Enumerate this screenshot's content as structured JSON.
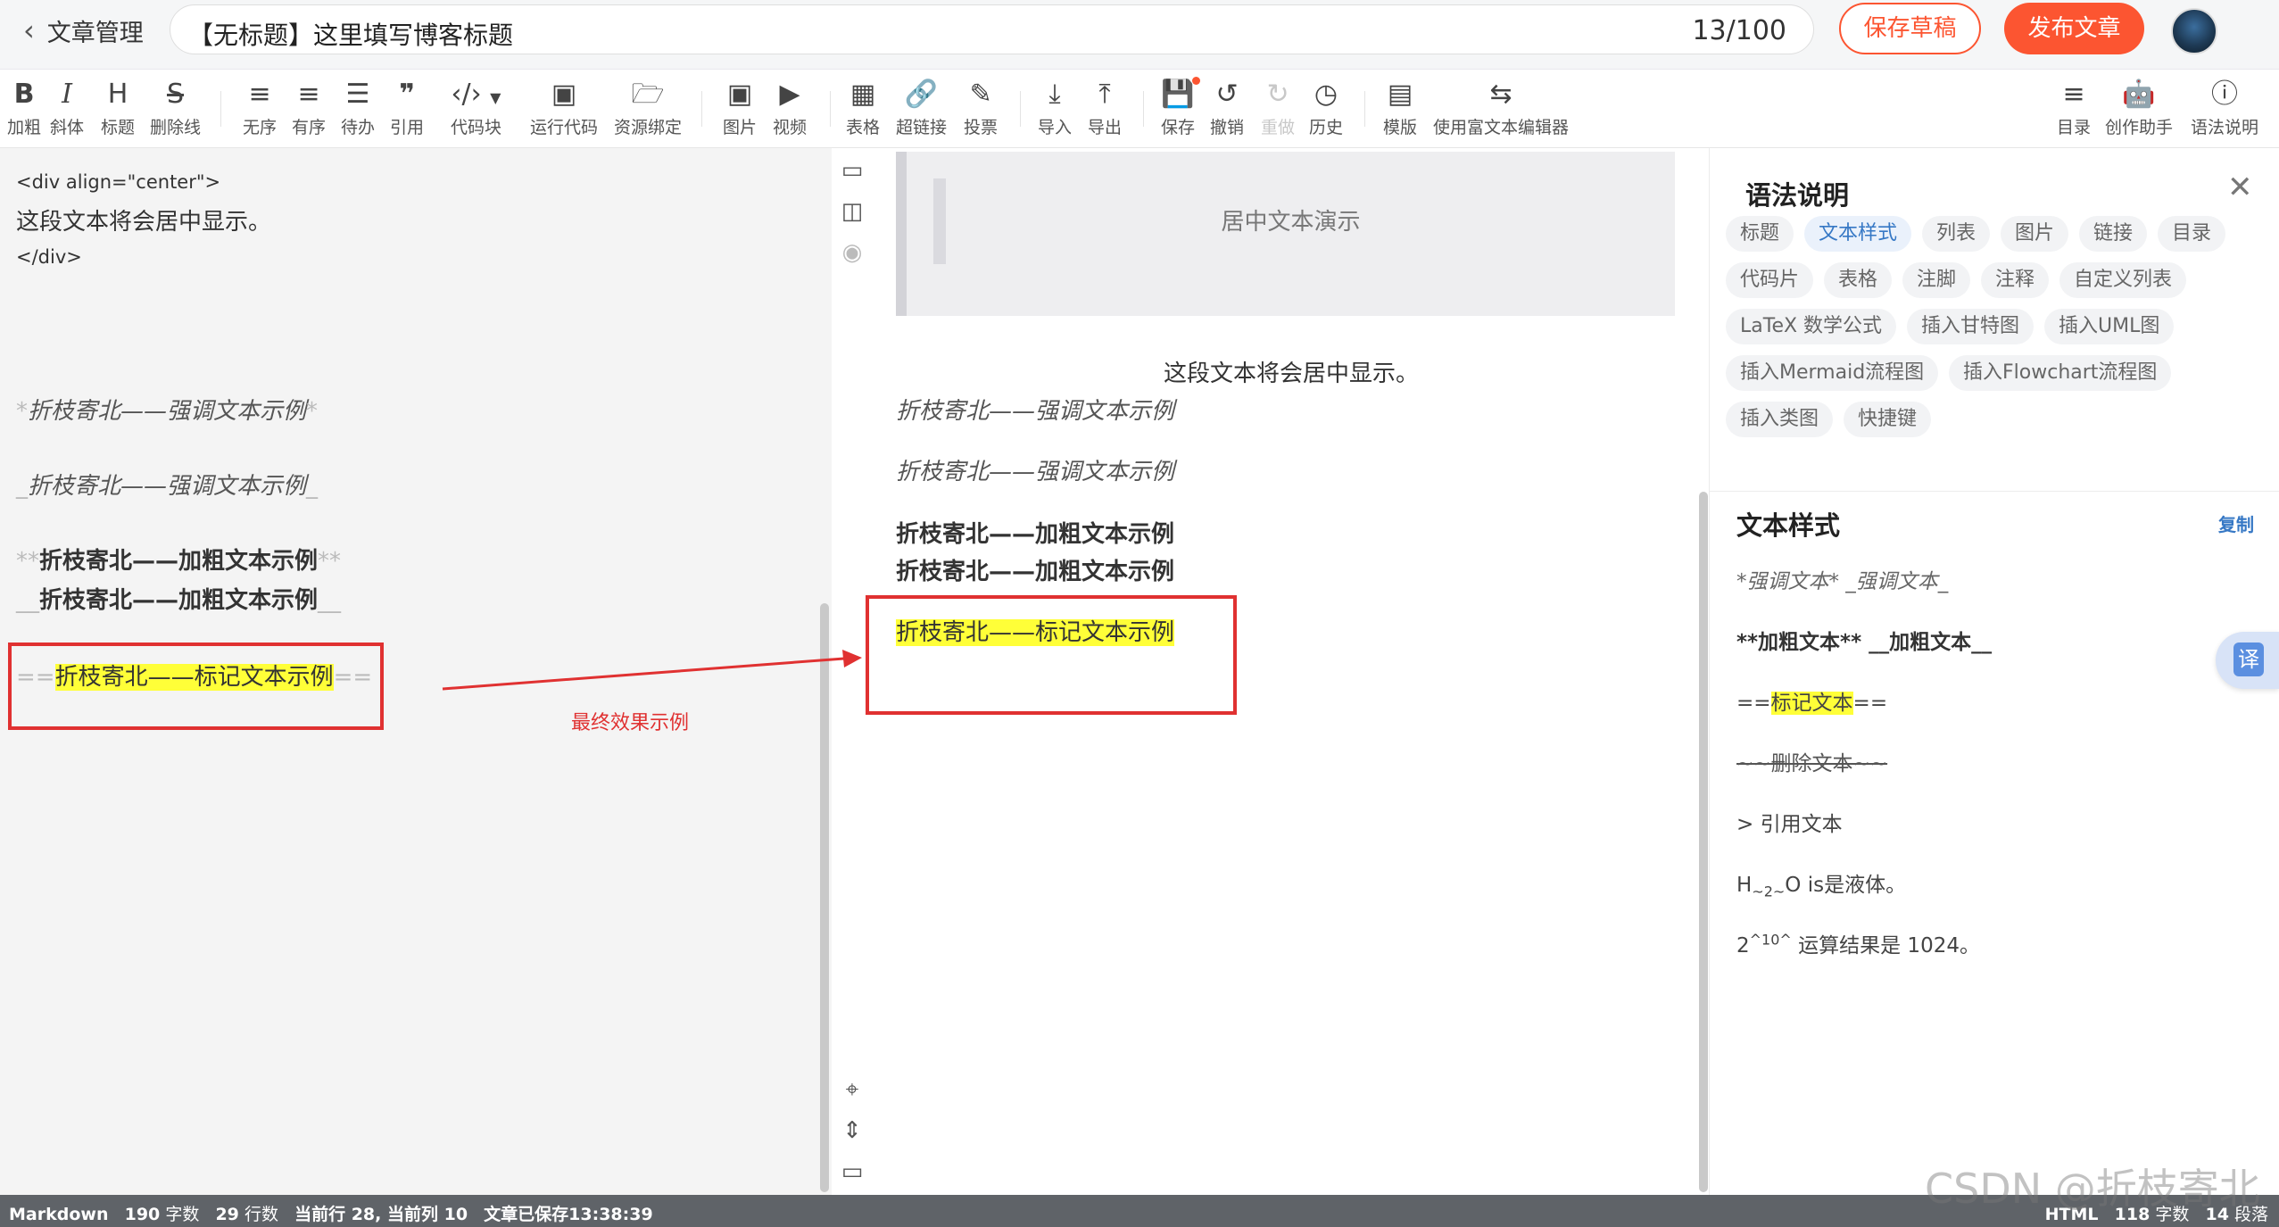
{
  "header": {
    "back_label": "文章管理",
    "title": "【无标题】这里填写博客标题",
    "title_count": "13/100",
    "save_draft": "保存草稿",
    "publish": "发布文章"
  },
  "toolbar": {
    "bold": "加粗",
    "italic": "斜体",
    "heading": "标题",
    "strike": "删除线",
    "unordered": "无序",
    "ordered": "有序",
    "todo": "待办",
    "quote": "引用",
    "codeblock": "代码块",
    "run_code": "运行代码",
    "resource": "资源绑定",
    "image": "图片",
    "video": "视频",
    "table": "表格",
    "link": "超链接",
    "vote": "投票",
    "import": "导入",
    "export": "导出",
    "save": "保存",
    "undo": "撤销",
    "redo": "重做",
    "history": "历史",
    "template": "模版",
    "rich_editor": "使用富文本编辑器",
    "toc": "目录",
    "assistant": "创作助手",
    "syntax_help": "语法说明"
  },
  "editor": {
    "line1": "<div align=\"center\">",
    "line2": "这段文本将会居中显示。",
    "line3": "</div>",
    "em_star_text": "折枝寄北——强调文本示例",
    "em_star_mark": "*",
    "em_us_text": "折枝寄北——强调文本示例",
    "em_us_mark": "_",
    "bold_star_mark": "**",
    "bold_star_text": "折枝寄北——加粗文本示例",
    "bold_us_mark": "__",
    "bold_us_text": "折枝寄北——加粗文本示例",
    "mark_marker": "==",
    "mark_text": "折枝寄北——标记文本示例"
  },
  "preview": {
    "quote_text": "居中文本演示",
    "center_text": "这段文本将会居中显示。",
    "em1": "折枝寄北——强调文本示例",
    "em2": "折枝寄北——强调文本示例",
    "bold1": "折枝寄北——加粗文本示例",
    "bold2": "折枝寄北——加粗文本示例",
    "mark": "折枝寄北——标记文本示例"
  },
  "annotation": {
    "label": "最终效果示例"
  },
  "panel": {
    "title": "语法说明",
    "tags": [
      "标题",
      "文本样式",
      "列表",
      "图片",
      "链接",
      "目录",
      "代码片",
      "表格",
      "注脚",
      "注释",
      "自定义列表",
      "LaTeX 数学公式",
      "插入甘特图",
      "插入UML图",
      "插入Mermaid流程图",
      "插入Flowchart流程图",
      "插入类图",
      "快捷键"
    ],
    "active_tag": "文本样式",
    "section_title": "文本样式",
    "copy": "复制",
    "ex_em": "*强调文本* _强调文本_",
    "ex_bold": "**加粗文本** __加粗文本__",
    "ex_mark_marker": "==",
    "ex_mark_text": "标记文本",
    "ex_del": "~~删除文本~~",
    "ex_quote": "> 引用文本",
    "ex_sub_pre": "H",
    "ex_sub": "~2~",
    "ex_sub_post": "O is是液体。",
    "ex_sup_pre": "2",
    "ex_sup": "^10^",
    "ex_sup_post": " 运算结果是 1024。",
    "translate": "译"
  },
  "status": {
    "mode": "Markdown",
    "chars": "190",
    "chars_unit": "字数",
    "lines": "29",
    "lines_unit": "行数",
    "cursor": "当前行 28, 当前列 10",
    "saved": "文章已保存13:38:39",
    "right_mode": "HTML",
    "right_chars": "118",
    "right_chars_unit": "字数",
    "right_paras": "14",
    "right_paras_unit": "段落"
  },
  "watermark": "CSDN @折枝寄北",
  "colors": {
    "accent": "#fc5531",
    "annotation": "#e03131",
    "highlight": "#ffff38",
    "link_blue": "#3678c5"
  }
}
